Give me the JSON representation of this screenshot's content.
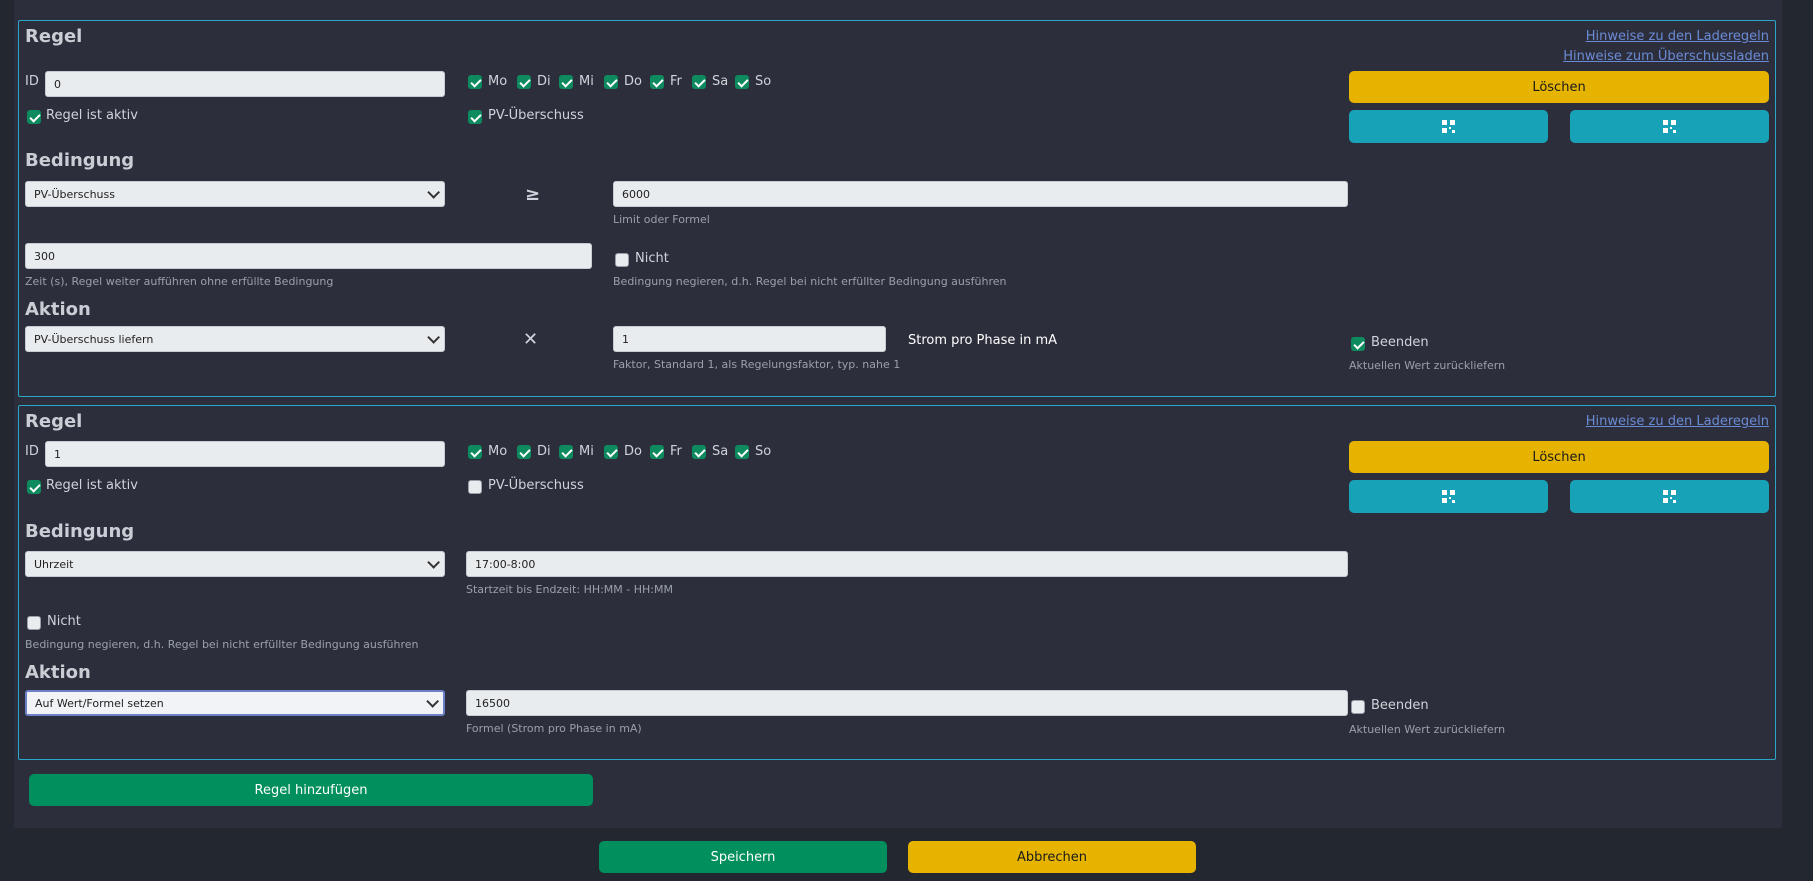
{
  "rule_heading": "Regel",
  "condition_heading": "Bedingung",
  "action_heading": "Aktion",
  "id_label": "ID",
  "days": [
    "Mo",
    "Di",
    "Mi",
    "Do",
    "Fr",
    "Sa",
    "So"
  ],
  "active_label": "Regel ist aktiv",
  "pv_label": "PV-Überschuss",
  "delete_label": "Löschen",
  "not_label": "Nicht",
  "not_hint": "Bedingung negieren, d.h. Regel bei nicht erfüllter Bedingung ausführen",
  "end_label": "Beenden",
  "end_hint": "Aktuellen Wert zurückliefern",
  "links": {
    "laderegeln": "Hinweise zu den Laderegeln",
    "ueberschuss": "Hinweise zum Überschussladen"
  },
  "rule1": {
    "id": "0",
    "condition_select": "PV-Überschuss",
    "operator": "≥",
    "limit": "6000",
    "limit_hint": "Limit oder Formel",
    "time": "300",
    "time_hint": "Zeit (s), Regel weiter aufführen ohne erfüllte Bedingung",
    "action_select": "PV-Überschuss liefern",
    "action_operator": "✕",
    "factor": "1",
    "factor_hint": "Faktor, Standard 1, als Regelungsfaktor, typ. nahe 1",
    "unit_text": "Strom pro Phase in mA"
  },
  "rule2": {
    "id": "1",
    "condition_select": "Uhrzeit",
    "time_range": "17:00-8:00",
    "time_range_hint": "Startzeit bis Endzeit: HH:MM - HH:MM",
    "action_select": "Auf Wert/Formel setzen",
    "formula": "16500",
    "formula_hint": "Formel (Strom pro Phase in mA)"
  },
  "add_rule_label": "Regel hinzufügen",
  "save_label": "Speichern",
  "cancel_label": "Abbrechen",
  "colors": {
    "accent_teal": "#17a2b8",
    "yellow": "#e6b400",
    "green": "#008f5d",
    "border": "#2aa6c9"
  }
}
